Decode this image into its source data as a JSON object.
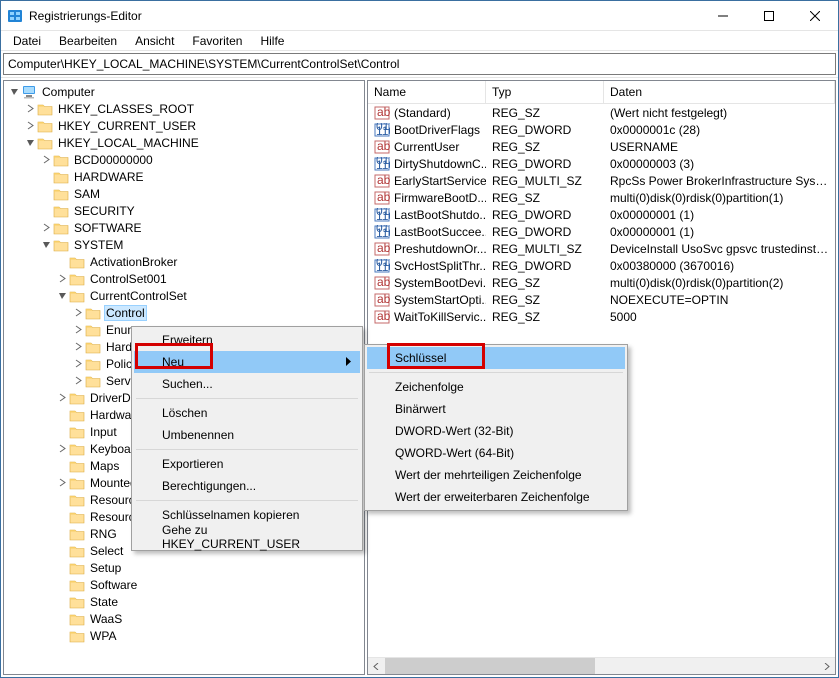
{
  "window": {
    "title": "Registrierungs-Editor"
  },
  "menubar": [
    "Datei",
    "Bearbeiten",
    "Ansicht",
    "Favoriten",
    "Hilfe"
  ],
  "address": "Computer\\HKEY_LOCAL_MACHINE\\SYSTEM\\CurrentControlSet\\Control",
  "tree": [
    {
      "level": 0,
      "exp": "open",
      "icon": "computer",
      "label": "Computer"
    },
    {
      "level": 1,
      "exp": "closed",
      "icon": "folder",
      "label": "HKEY_CLASSES_ROOT"
    },
    {
      "level": 1,
      "exp": "closed",
      "icon": "folder",
      "label": "HKEY_CURRENT_USER"
    },
    {
      "level": 1,
      "exp": "open",
      "icon": "folder",
      "label": "HKEY_LOCAL_MACHINE"
    },
    {
      "level": 2,
      "exp": "closed",
      "icon": "folder",
      "label": "BCD00000000"
    },
    {
      "level": 2,
      "exp": "none",
      "icon": "folder",
      "label": "HARDWARE"
    },
    {
      "level": 2,
      "exp": "none",
      "icon": "folder",
      "label": "SAM"
    },
    {
      "level": 2,
      "exp": "none",
      "icon": "folder",
      "label": "SECURITY"
    },
    {
      "level": 2,
      "exp": "closed",
      "icon": "folder",
      "label": "SOFTWARE"
    },
    {
      "level": 2,
      "exp": "open",
      "icon": "folder",
      "label": "SYSTEM"
    },
    {
      "level": 3,
      "exp": "none",
      "icon": "folder",
      "label": "ActivationBroker"
    },
    {
      "level": 3,
      "exp": "closed",
      "icon": "folder",
      "label": "ControlSet001"
    },
    {
      "level": 3,
      "exp": "open",
      "icon": "folder",
      "label": "CurrentControlSet"
    },
    {
      "level": 4,
      "exp": "closed",
      "icon": "folder",
      "label": "Control",
      "selected": true
    },
    {
      "level": 4,
      "exp": "closed",
      "icon": "folder",
      "label": "Enum"
    },
    {
      "level": 4,
      "exp": "closed",
      "icon": "folder",
      "label": "Hardware Profiles"
    },
    {
      "level": 4,
      "exp": "closed",
      "icon": "folder",
      "label": "Policies"
    },
    {
      "level": 4,
      "exp": "closed",
      "icon": "folder",
      "label": "Services"
    },
    {
      "level": 3,
      "exp": "closed",
      "icon": "folder",
      "label": "DriverDatabase"
    },
    {
      "level": 3,
      "exp": "none",
      "icon": "folder",
      "label": "HardwareConfig"
    },
    {
      "level": 3,
      "exp": "none",
      "icon": "folder",
      "label": "Input"
    },
    {
      "level": 3,
      "exp": "closed",
      "icon": "folder",
      "label": "Keyboard Layout"
    },
    {
      "level": 3,
      "exp": "none",
      "icon": "folder",
      "label": "Maps"
    },
    {
      "level": 3,
      "exp": "closed",
      "icon": "folder",
      "label": "MountedDevices"
    },
    {
      "level": 3,
      "exp": "none",
      "icon": "folder",
      "label": "ResourceManager"
    },
    {
      "level": 3,
      "exp": "none",
      "icon": "folder",
      "label": "ResourcePolicyStore"
    },
    {
      "level": 3,
      "exp": "none",
      "icon": "folder",
      "label": "RNG"
    },
    {
      "level": 3,
      "exp": "none",
      "icon": "folder",
      "label": "Select"
    },
    {
      "level": 3,
      "exp": "none",
      "icon": "folder",
      "label": "Setup"
    },
    {
      "level": 3,
      "exp": "none",
      "icon": "folder",
      "label": "Software"
    },
    {
      "level": 3,
      "exp": "none",
      "icon": "folder",
      "label": "State"
    },
    {
      "level": 3,
      "exp": "none",
      "icon": "folder",
      "label": "WaaS"
    },
    {
      "level": 3,
      "exp": "none",
      "icon": "folder",
      "label": "WPA"
    }
  ],
  "list_header": {
    "name": "Name",
    "type": "Typ",
    "data": "Daten"
  },
  "list_rows": [
    {
      "icon": "str",
      "name": "(Standard)",
      "type": "REG_SZ",
      "data": "(Wert nicht festgelegt)"
    },
    {
      "icon": "bin",
      "name": "BootDriverFlags",
      "type": "REG_DWORD",
      "data": "0x0000001c (28)"
    },
    {
      "icon": "str",
      "name": "CurrentUser",
      "type": "REG_SZ",
      "data": "USERNAME"
    },
    {
      "icon": "bin",
      "name": "DirtyShutdownC...",
      "type": "REG_DWORD",
      "data": "0x00000003 (3)"
    },
    {
      "icon": "str",
      "name": "EarlyStartServices",
      "type": "REG_MULTI_SZ",
      "data": "RpcSs Power BrokerInfrastructure SystemEv"
    },
    {
      "icon": "str",
      "name": "FirmwareBootD...",
      "type": "REG_SZ",
      "data": "multi(0)disk(0)rdisk(0)partition(1)"
    },
    {
      "icon": "bin",
      "name": "LastBootShutdo...",
      "type": "REG_DWORD",
      "data": "0x00000001 (1)"
    },
    {
      "icon": "bin",
      "name": "LastBootSuccee...",
      "type": "REG_DWORD",
      "data": "0x00000001 (1)"
    },
    {
      "icon": "str",
      "name": "PreshutdownOr...",
      "type": "REG_MULTI_SZ",
      "data": "DeviceInstall UsoSvc gpsvc trustedinstaller"
    },
    {
      "icon": "bin",
      "name": "SvcHostSplitThr...",
      "type": "REG_DWORD",
      "data": "0x00380000 (3670016)"
    },
    {
      "icon": "str",
      "name": "SystemBootDevi...",
      "type": "REG_SZ",
      "data": "multi(0)disk(0)rdisk(0)partition(2)"
    },
    {
      "icon": "str",
      "name": "SystemStartOpti...",
      "type": "REG_SZ",
      "data": "  NOEXECUTE=OPTIN"
    },
    {
      "icon": "str",
      "name": "WaitToKillServic...",
      "type": "REG_SZ",
      "data": "5000"
    }
  ],
  "ctx_main": {
    "expand": "Erweitern",
    "new": "Neu",
    "find": "Suchen...",
    "delete": "Löschen",
    "rename": "Umbenennen",
    "export": "Exportieren",
    "perms": "Berechtigungen...",
    "copykey": "Schlüsselnamen kopieren",
    "goto": "Gehe zu HKEY_CURRENT_USER"
  },
  "ctx_sub": {
    "key": "Schlüssel",
    "string": "Zeichenfolge",
    "binary": "Binärwert",
    "dword": "DWORD-Wert (32-Bit)",
    "qword": "QWORD-Wert (64-Bit)",
    "multi": "Wert der mehrteiligen Zeichenfolge",
    "expand": "Wert der erweiterbaren Zeichenfolge"
  }
}
